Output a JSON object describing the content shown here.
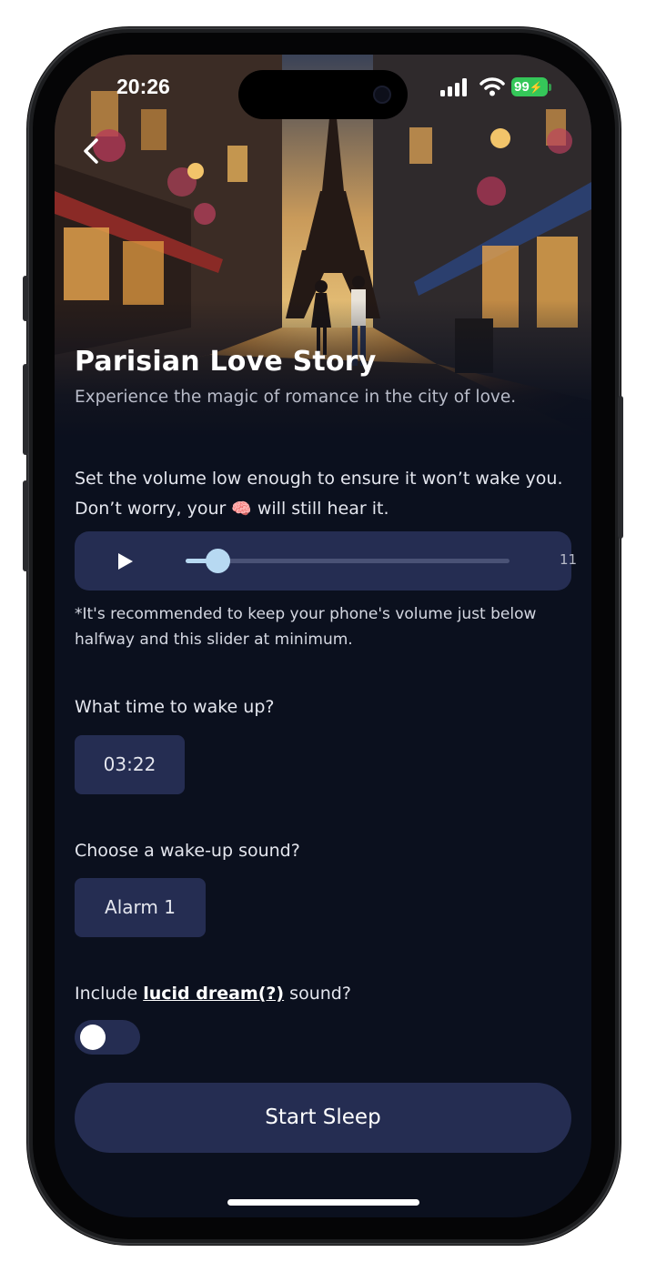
{
  "status_bar": {
    "time": "20:26",
    "battery": "99",
    "icons": [
      "cellular-signal-icon",
      "wifi-icon",
      "battery-charging-icon"
    ]
  },
  "header": {
    "back_icon": "chevron-left-icon",
    "title": "Parisian Love Story",
    "subtitle": "Experience the magic of romance in the city of love."
  },
  "volume": {
    "description_part1": "Set the volume low enough to ensure it won’t wake you. Don’t worry, your",
    "brain_emoji": "🧠",
    "description_part2": "will still hear it.",
    "play_icon": "play-icon",
    "level": 11,
    "level_label": "11",
    "level_fraction": 0.1,
    "note": "*It's recommended to keep your phone's volume just below halfway and this slider at minimum."
  },
  "wake": {
    "question": "What time to wake up?",
    "time": "03:22"
  },
  "sound": {
    "question": "Choose a wake-up sound?",
    "selected": "Alarm 1"
  },
  "lucid": {
    "prefix": "Include",
    "link": "lucid dream(?)",
    "suffix": "sound?",
    "enabled": false
  },
  "actions": {
    "start_label": "Start Sleep"
  },
  "colors": {
    "background": "#0b101e",
    "surface": "#252d52",
    "accent": "#b7d9f2",
    "battery": "#35c759"
  }
}
